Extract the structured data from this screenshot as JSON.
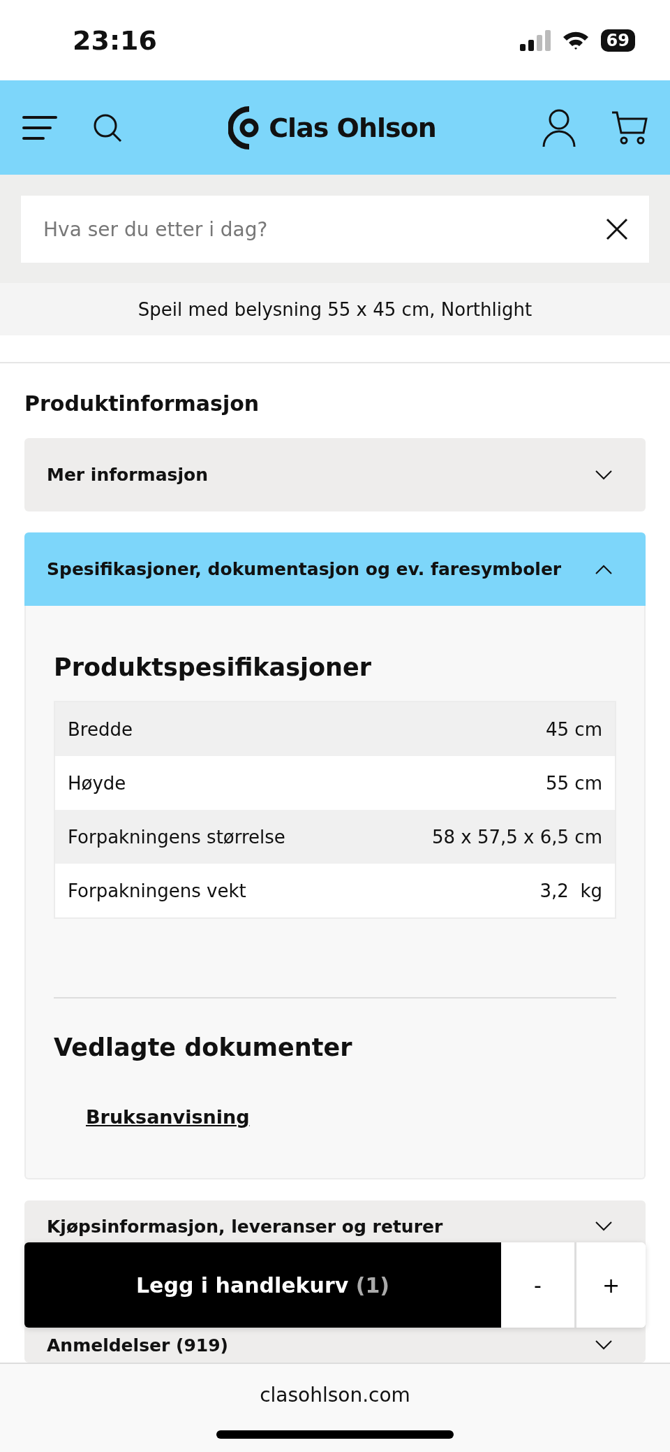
{
  "status_bar": {
    "time": "23:16",
    "battery": "69"
  },
  "header": {
    "logo": "Clas Ohlson"
  },
  "search": {
    "placeholder": "Hva ser du etter i dag?"
  },
  "product_title": "Speil med belysning 55 x 45 cm, Northlight",
  "section_title": "Produktinformasjon",
  "accordions": [
    {
      "title": "Mer informasjon",
      "expanded": false
    },
    {
      "title": "Spesifikasjoner, dokumentasjon og ev. faresymboler",
      "expanded": true,
      "specs_title": "Produktspesifikasjoner",
      "specs": [
        {
          "label": "Bredde",
          "value": "45 cm"
        },
        {
          "label": "Høyde",
          "value": "55 cm"
        },
        {
          "label": "Forpakningens størrelse",
          "value": "58 x 57,5 x 6,5 cm"
        },
        {
          "label": "Forpakningens vekt",
          "value": "3,2  kg"
        }
      ],
      "documents_title": "Vedlagte dokumenter",
      "documents": [
        "Bruksanvisning"
      ]
    },
    {
      "title": "Kjøpsinformasjon, leveranser og returer",
      "expanded": false
    },
    {
      "title": "Anmeldelser (919)",
      "expanded": false
    }
  ],
  "cart_bar": {
    "button": "Legg i handlekurv",
    "count": "(1)",
    "minus": "-",
    "plus": "+"
  },
  "browser": {
    "url": "clasohlson.com"
  }
}
